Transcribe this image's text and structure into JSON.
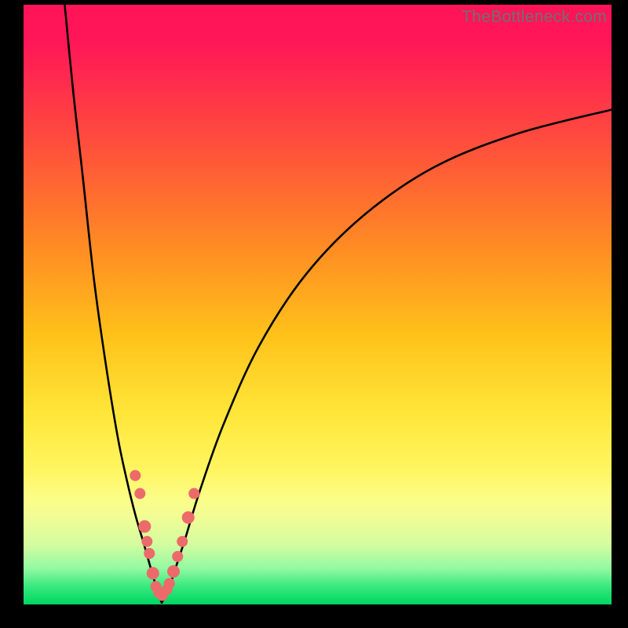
{
  "watermark": "TheBottleneck.com",
  "chart_data": {
    "type": "line",
    "title": "",
    "xlabel": "",
    "ylabel": "",
    "xlim": [
      0,
      100
    ],
    "ylim": [
      0,
      100
    ],
    "series": [
      {
        "name": "left-curve",
        "x": [
          7,
          8.5,
          10,
          12,
          14,
          16,
          17.5,
          19,
          20.5,
          21.5,
          22.3,
          23,
          23.5
        ],
        "y": [
          100,
          85,
          72,
          54,
          40,
          28,
          21,
          15,
          10,
          6.5,
          3.8,
          1.6,
          0.3
        ]
      },
      {
        "name": "right-curve",
        "x": [
          23.5,
          24.2,
          25,
          26,
          27.5,
          30,
          34,
          40,
          48,
          58,
          70,
          84,
          100
        ],
        "y": [
          0.3,
          1.5,
          3.5,
          6.5,
          11,
          19,
          30,
          43,
          55,
          65,
          73,
          78.5,
          82.5
        ]
      }
    ],
    "markers": {
      "name": "data-points",
      "color": "#ec6a6a",
      "points": [
        {
          "x": 19.0,
          "y": 21.5,
          "r": 7
        },
        {
          "x": 19.8,
          "y": 18.5,
          "r": 7
        },
        {
          "x": 20.6,
          "y": 13.0,
          "r": 8
        },
        {
          "x": 21.0,
          "y": 10.5,
          "r": 7
        },
        {
          "x": 21.4,
          "y": 8.5,
          "r": 7
        },
        {
          "x": 22.0,
          "y": 5.2,
          "r": 8
        },
        {
          "x": 22.5,
          "y": 3.0,
          "r": 7
        },
        {
          "x": 23.0,
          "y": 2.0,
          "r": 7
        },
        {
          "x": 23.6,
          "y": 1.5,
          "r": 7
        },
        {
          "x": 24.4,
          "y": 2.5,
          "r": 7
        },
        {
          "x": 24.8,
          "y": 3.5,
          "r": 7
        },
        {
          "x": 25.5,
          "y": 5.5,
          "r": 8
        },
        {
          "x": 26.2,
          "y": 8.0,
          "r": 7
        },
        {
          "x": 27.0,
          "y": 10.5,
          "r": 7
        },
        {
          "x": 28.0,
          "y": 14.5,
          "r": 8
        },
        {
          "x": 29.0,
          "y": 18.5,
          "r": 7
        }
      ]
    }
  }
}
